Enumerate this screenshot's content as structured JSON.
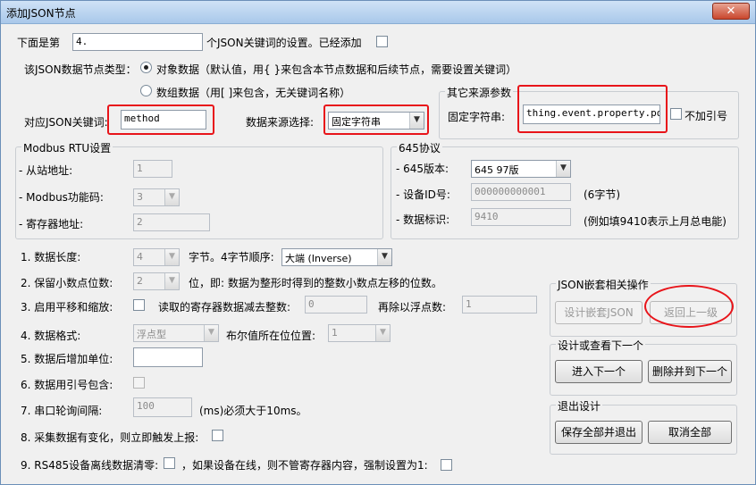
{
  "window": {
    "title": "添加JSON节点",
    "close_glyph": "✕"
  },
  "header": {
    "prefix": "下面是第",
    "index_value": "4.",
    "suffix": "个JSON关键词的设置。已经添加"
  },
  "node_type": {
    "label": "该JSON数据节点类型：",
    "object_option": "对象数据（默认值，用{ }来包含本节点数据和后续节点，需要设置关键词）",
    "array_option": "数组数据（用[ ]来包含，无关键词名称）",
    "selected": "object"
  },
  "json_key": {
    "label": "对应JSON关键词:",
    "value": "method"
  },
  "data_source": {
    "label": "数据来源选择:",
    "value": "固定字符串"
  },
  "other_source": {
    "group_title": "其它来源参数",
    "fixed_label": "固定字符串:",
    "fixed_value": "thing.event.property.post",
    "no_quote_label": "不加引号"
  },
  "modbus": {
    "group_title": "Modbus RTU设置",
    "slave_label": "- 从站地址:",
    "slave_value": "1",
    "func_label": "- Modbus功能码:",
    "func_value": "3",
    "reg_label": "- 寄存器地址:",
    "reg_value": "2"
  },
  "p645": {
    "group_title": "645协议",
    "version_label": "- 645版本:",
    "version_value": "645 97版",
    "device_label": "- 设备ID号:",
    "device_value": "000000000001",
    "device_hint": "(6字节)",
    "mark_label": "- 数据标识:",
    "mark_value": "9410",
    "mark_hint": "(例如填9410表示上月总电能)"
  },
  "settings": {
    "r1": {
      "label": "1. 数据长度:",
      "len_value": "4",
      "unit": "字节。4字节顺序:",
      "order_value": "大端 (Inverse)"
    },
    "r2": {
      "label": "2. 保留小数点位数:",
      "value": "2",
      "desc": "位，即: 数据为整形时得到的整数小数点左移的位数。"
    },
    "r3": {
      "label": "3. 启用平移和缩放:",
      "sub_label": "读取的寄存器数据减去整数:",
      "sub_value": "0",
      "div_label": "再除以浮点数:",
      "div_value": "1"
    },
    "r4": {
      "label": "4. 数据格式:",
      "format_value": "浮点型",
      "bool_label": "布尔值所在位位置:",
      "bool_value": "1"
    },
    "r5": {
      "label": "5. 数据后增加单位:",
      "value": ""
    },
    "r6": {
      "label": "6. 数据用引号包含:"
    },
    "r7": {
      "label": "7. 串口轮询间隔:",
      "value": "100",
      "hint": "(ms)必须大于10ms。"
    },
    "r8": {
      "label": "8. 采集数据有变化，则立即触发上报:"
    },
    "r9": {
      "label": "9. RS485设备离线数据清零:",
      "mid": "，如果设备在线，则不管寄存器内容，强制设置为1:"
    }
  },
  "nested_ops": {
    "group_title": "JSON嵌套相关操作",
    "design_btn": "设计嵌套JSON",
    "back_btn": "返回上一级"
  },
  "next_ops": {
    "group_title": "设计或查看下一个",
    "enter_btn": "进入下一个",
    "delete_btn": "删除并到下一个"
  },
  "exit_ops": {
    "group_title": "退出设计",
    "save_btn": "保存全部并退出",
    "cancel_btn": "取消全部"
  },
  "colors": {
    "highlight": "#e8141a",
    "titlebar": "#a9c8ea",
    "close": "#c9472d"
  }
}
